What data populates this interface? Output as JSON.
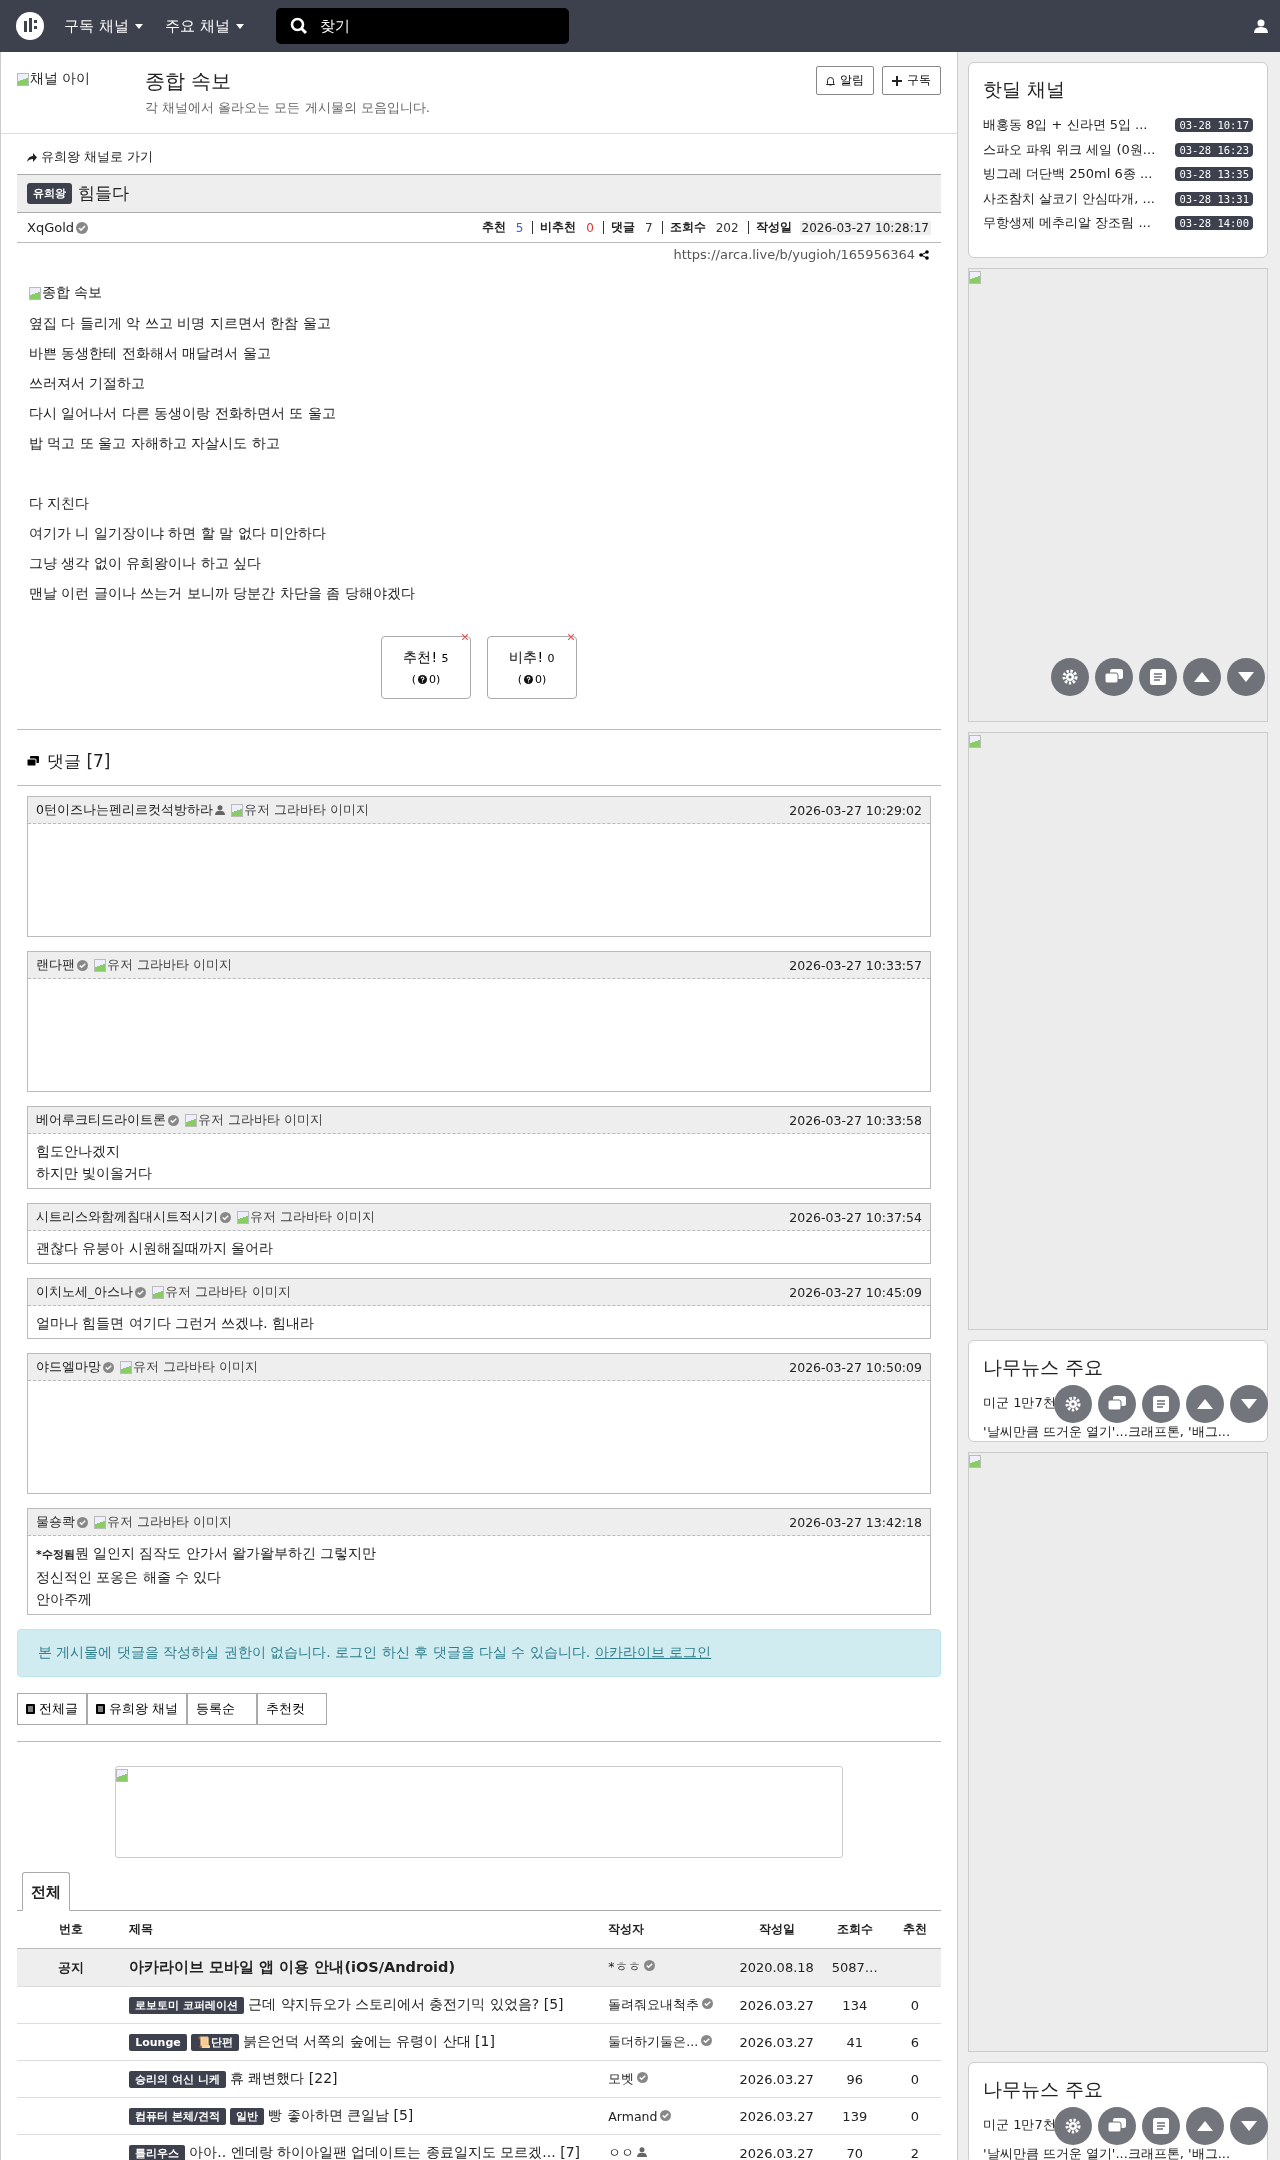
{
  "navbar": {
    "menus": [
      "구독 채널",
      "주요 채널"
    ],
    "search": {
      "placeholder": "찾기"
    }
  },
  "channel": {
    "icon_alt": "채널 아이",
    "title": "종합 속보",
    "description": "각 채널에서 올라오는 모든 게시물의 모음입니다.",
    "buttons": [
      "알림",
      "구독"
    ]
  },
  "post": {
    "back_link": "유희왕 채널로 가기",
    "category": "유희왕",
    "title": "힘들다",
    "author": "XqGold",
    "stats": [
      {
        "label": "추천",
        "value": "5",
        "kind": "up"
      },
      {
        "label": "비추천",
        "value": "0",
        "kind": "down"
      },
      {
        "label": "댓글",
        "value": "7",
        "kind": "plain"
      },
      {
        "label": "조회수",
        "value": "202",
        "kind": "plain"
      },
      {
        "label": "작성일",
        "value": "2026-03-27 10:28:17",
        "kind": "date"
      }
    ],
    "url": "https://arca.live/b/yugioh/165956364",
    "image_alt": "종합 속보",
    "paragraphs": [
      [
        "옆집 다 들리게 악 쓰고 비명 지르면서 한참 울고",
        "바쁜 동생한테 전화해서 매달려서 울고",
        "쓰러져서 기절하고",
        "다시 일어나서 다른 동생이랑 전화하면서 또 울고",
        "밥 먹고 또 울고 자해하고 자살시도 하고"
      ],
      [
        "다 지친다",
        "여기가 니 일기장이냐 하면 할 말 없다 미안하다",
        "그냥 생각 없이 유희왕이나 하고 싶다",
        "맨날 이런 글이나 쓰는거 보니까 당분간 차단을 좀 당해야겠다"
      ]
    ],
    "votes": [
      {
        "label": "추천!",
        "count": "5",
        "open": "(",
        "sub": "0)"
      },
      {
        "label": "비추!",
        "count": "0",
        "open": "(",
        "sub": "0)"
      }
    ]
  },
  "comments": {
    "title": "댓글 [7]",
    "items": [
      {
        "author": {
          "name": "0턴이즈나는펜리르컷석방하라",
          "kind": "user"
        },
        "avatar_alt": "유저 그라바타 이미지",
        "time": "2026-03-27 10:29:02",
        "kind": "sticker"
      },
      {
        "author": {
          "name": "랜다팬",
          "kind": "verified"
        },
        "avatar_alt": "유저 그라바타 이미지",
        "time": "2026-03-27 10:33:57",
        "kind": "sticker"
      },
      {
        "author": {
          "name": "베어루크티드라이트론",
          "kind": "verified"
        },
        "avatar_alt": "유저 그라바타 이미지",
        "time": "2026-03-27 10:33:58",
        "kind": "text",
        "lines": [
          "힘도안나겠지",
          "하지만 빛이올거다"
        ]
      },
      {
        "author": {
          "name": "시트리스와함께침대시트적시기",
          "kind": "verified"
        },
        "avatar_alt": "유저 그라바타 이미지",
        "time": "2026-03-27 10:37:54",
        "kind": "text",
        "lines": [
          "괜찮다 유붕아 시원해질때까지 울어라"
        ]
      },
      {
        "author": {
          "name": "이치노세_아스나",
          "kind": "verified"
        },
        "avatar_alt": "유저 그라바타 이미지",
        "time": "2026-03-27 10:45:09",
        "kind": "text",
        "lines": [
          "얼마나 힘들면 여기다 그런거 쓰겠냐. 힘내라"
        ]
      },
      {
        "author": {
          "name": "야드엘마망",
          "kind": "verified"
        },
        "avatar_alt": "유저 그라바타 이미지",
        "time": "2026-03-27 10:50:09",
        "kind": "sticker"
      },
      {
        "author": {
          "name": "물숑콱",
          "kind": "verified"
        },
        "avatar_alt": "유저 그라바타 이미지",
        "time": "2026-03-27 13:42:18",
        "kind": "text",
        "edited": "*수정됨",
        "lines": [
          "뭔 일인지 짐작도 안가서 왈가왈부하긴 그렇지만",
          "정신적인 포옹은 해줄 수 있다",
          "안아주께"
        ]
      }
    ]
  },
  "notice": {
    "text": "본 게시물에 댓글을 작성하실 권한이 없습니다. 로그인 하신 후 댓글을 다실 수 있습니다.",
    "link": "아카라이브 로그인"
  },
  "list_buttons": [
    {
      "label": "전체글",
      "icon": true
    },
    {
      "label": "유희왕 채널",
      "icon": true
    },
    {
      "label": "등록순",
      "icon": false
    },
    {
      "label": "추천컷",
      "icon": false
    }
  ],
  "board": {
    "tabs": [
      {
        "label": "전체",
        "selected": true
      }
    ],
    "columns": [
      "번호",
      "제목",
      "작성자",
      "작성일",
      "조회수",
      "추천"
    ],
    "rows": [
      {
        "kind": "notice",
        "number": "공지",
        "tags": [],
        "title": "아카라이브 모바일 앱 이용 안내(iOS/Android)",
        "author": {
          "name": "*ㅎㅎ",
          "kind": "verified"
        },
        "date": "2020.08.18",
        "views": "5087…",
        "likes": ""
      },
      {
        "kind": "post",
        "tags": [
          "로보토미 코퍼레이션"
        ],
        "title": "근데 약지듀오가 스토리에서 충전기믹 있었음? [5]",
        "author": {
          "name": "돌려줘요내척추",
          "kind": "verified"
        },
        "date": "2026.03.27",
        "views": "134",
        "likes": "0"
      },
      {
        "kind": "post",
        "tags": [
          "Lounge",
          "📜단편"
        ],
        "title": "붉은언덕 서쪽의 숲에는 유령이 산대 [1]",
        "author": {
          "name": "둘더하기둘은...",
          "kind": "verified"
        },
        "date": "2026.03.27",
        "views": "41",
        "likes": "6"
      },
      {
        "kind": "post",
        "tags": [
          "승리의 여신 니케"
        ],
        "title": "휴 쾌변했다 [22]",
        "author": {
          "name": "모벳",
          "kind": "verified"
        },
        "date": "2026.03.27",
        "views": "96",
        "likes": "0"
      },
      {
        "kind": "post",
        "tags": [
          "컴퓨터 본체/견적",
          "일반"
        ],
        "title": "빵 좋아하면 큰일남 [5]",
        "author": {
          "name": "Armand",
          "kind": "verified"
        },
        "date": "2026.03.27",
        "views": "139",
        "likes": "0"
      },
      {
        "kind": "post",
        "tags": [
          "틀리우스"
        ],
        "title": "아아.. 엔데랑 하이아일팬 업데이트는 종료일지도 모르겠... [7]",
        "author": {
          "name": "ㅇㅇ",
          "kind": "user"
        },
        "date": "2026.03.27",
        "views": "70",
        "likes": "2"
      }
    ]
  },
  "sidebar": {
    "hotdeal": {
      "title": "핫딜 채널",
      "items": [
        {
          "text": "배홍동 8입 + 신라면 5입 ...",
          "time": "03-28 10:17"
        },
        {
          "text": "스파오 파워 위크 세일 (0원...",
          "time": "03-28 16:23"
        },
        {
          "text": "빙그레 더단백 250ml 6종 ...",
          "time": "03-28 13:35"
        },
        {
          "text": "사조참치 살코기 안심따개, ...",
          "time": "03-28 13:31"
        },
        {
          "text": "무항생제 메추리알 장조림 ...",
          "time": "03-28 14:00"
        }
      ]
    },
    "blocks": [
      {
        "kind": "ad"
      },
      {
        "kind": "ad"
      },
      {
        "kind": "news",
        "title": "나무뉴스 주요",
        "items": [
          "미군 1만7천",
          "'날씨만큼 뜨거운 열기'...크래프톤, '배그..."
        ]
      },
      {
        "kind": "ad"
      },
      {
        "kind": "news",
        "title": "나무뉴스 주요",
        "items": [
          "미군 1만7천",
          "'날씨만큼 뜨거운 열기'...크래프톤, '배그..."
        ]
      }
    ]
  }
}
